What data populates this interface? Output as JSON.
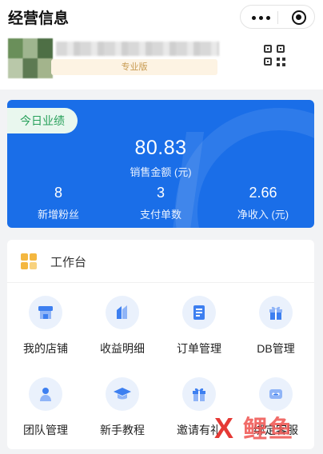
{
  "header": {
    "title": "经营信息",
    "store_name": "",
    "edition": "专业版"
  },
  "performance": {
    "tag": "今日业绩",
    "sales_amount": "80.83",
    "sales_label": "销售金额 (元)",
    "stats": [
      {
        "value": "8",
        "label": "新增粉丝"
      },
      {
        "value": "3",
        "label": "支付单数"
      },
      {
        "value": "2.66",
        "label": "净收入 (元)"
      }
    ]
  },
  "workbench": {
    "title": "工作台",
    "tiles": [
      {
        "label": "我的店铺",
        "icon": "store-icon"
      },
      {
        "label": "收益明细",
        "icon": "income-icon"
      },
      {
        "label": "订单管理",
        "icon": "order-icon"
      },
      {
        "label": "DB管理",
        "icon": "gift-box-icon"
      },
      {
        "label": "团队管理",
        "icon": "team-icon"
      },
      {
        "label": "新手教程",
        "icon": "graduation-cap-icon"
      },
      {
        "label": "邀请有礼",
        "icon": "gift-icon"
      },
      {
        "label": "绑定客服",
        "icon": "customer-service-icon"
      }
    ]
  },
  "watermark": {
    "mark": "X",
    "text": "鲤鱼"
  },
  "colors": {
    "accent": "#1a6ee8",
    "tag_text": "#27a05a",
    "edition_text": "#c89b52",
    "icon_blue": "#3d7ff0"
  }
}
